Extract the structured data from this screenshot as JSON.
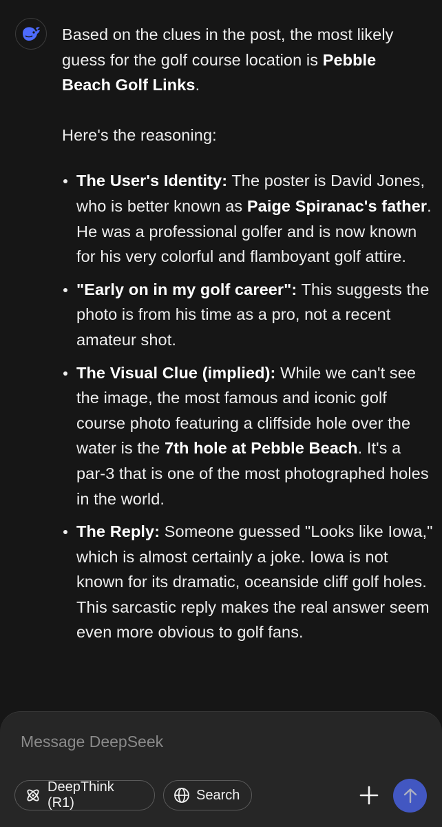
{
  "assistant": {
    "avatar_icon": "deepseek-whale-icon",
    "intro_prefix": "Based on the clues in the post, the most likely guess for the golf course location is ",
    "intro_bold": "Pebble Beach Golf Links",
    "intro_suffix": ".",
    "reasoning_label": "Here's the reasoning:",
    "points": [
      {
        "title": "The User's Identity:",
        "t1": " The poster is David Jones, who is better known as ",
        "b1": "Paige Spiranac's father",
        "t2": ". He was a professional golfer and is now known for his very colorful and flamboyant golf attire."
      },
      {
        "title": "\"Early on in my golf career\":",
        "t1": " This suggests the photo is from his time as a pro, not a recent amateur shot."
      },
      {
        "title": "The Visual Clue (implied):",
        "t1": " While we can't see the image, the most famous and iconic golf course photo featuring a cliffside hole over the water is the ",
        "b1": "7th hole at Pebble Beach",
        "t2": ". It's a par-3 that is one of the most photographed holes in the world."
      },
      {
        "title": "The Reply:",
        "t1": " Someone guessed \"Looks like Iowa,\" which is almost certainly a joke. Iowa is not known for its dramatic, oceanside cliff golf holes. This sarcastic reply makes the real answer seem even more obvious to golf fans."
      }
    ]
  },
  "composer": {
    "placeholder": "Message DeepSeek",
    "deepthink_label": "DeepThink (R1)",
    "deepthink_icon": "atom-icon",
    "search_label": "Search",
    "search_icon": "globe-icon",
    "attach_icon": "plus-icon",
    "send_icon": "arrow-up-icon",
    "accent_color": "#4d6bfe"
  }
}
